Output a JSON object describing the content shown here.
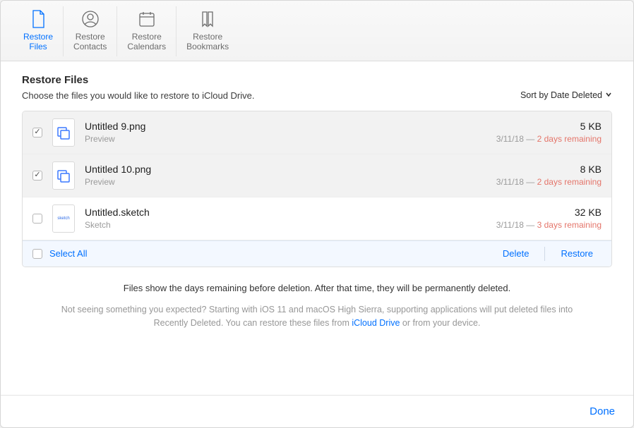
{
  "tabs": [
    {
      "label": "Restore\nFiles",
      "active": true
    },
    {
      "label": "Restore\nContacts",
      "active": false
    },
    {
      "label": "Restore\nCalendars",
      "active": false
    },
    {
      "label": "Restore\nBookmarks",
      "active": false
    }
  ],
  "title": "Restore Files",
  "subtitle": "Choose the files you would like to restore to iCloud Drive.",
  "sort_label": "Sort by Date Deleted",
  "files": [
    {
      "checked": true,
      "name": "Untitled 9.png",
      "app": "Preview",
      "size": "5 KB",
      "date": "3/11/18",
      "remaining": "2 days remaining",
      "icon": "preview"
    },
    {
      "checked": true,
      "name": "Untitled 10.png",
      "app": "Preview",
      "size": "8 KB",
      "date": "3/11/18",
      "remaining": "2 days remaining",
      "icon": "preview"
    },
    {
      "checked": false,
      "name": "Untitled.sketch",
      "app": "Sketch",
      "size": "32 KB",
      "date": "3/11/18",
      "remaining": "3 days remaining",
      "icon": "sketch"
    }
  ],
  "footer": {
    "select_all": "Select All",
    "delete": "Delete",
    "restore": "Restore"
  },
  "info": "Files show the days remaining before deletion. After that time, they will be permanently deleted.",
  "info2a": "Not seeing something you expected? Starting with iOS 11 and macOS High Sierra, supporting applications will put deleted files into Recently Deleted. You can restore these files from ",
  "info2link": "iCloud Drive",
  "info2b": " or from your device.",
  "done": "Done"
}
